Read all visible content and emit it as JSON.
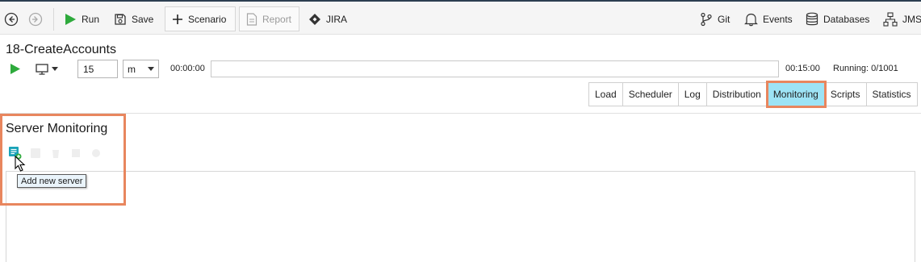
{
  "toolbar": {
    "run_label": "Run",
    "save_label": "Save",
    "scenario_label": "Scenario",
    "report_label": "Report",
    "jira_label": "JIRA",
    "git_label": "Git",
    "events_label": "Events",
    "databases_label": "Databases",
    "jms_label": "JMS"
  },
  "test": {
    "title": "18-CreateAccounts",
    "duration_value": "15",
    "duration_unit": "m",
    "elapsed_time": "00:00:00",
    "end_time": "00:15:00",
    "running_status": "Running: 0/1001",
    "progress_fraction": 0
  },
  "tabs": [
    {
      "label": "Load"
    },
    {
      "label": "Scheduler"
    },
    {
      "label": "Log"
    },
    {
      "label": "Distribution"
    },
    {
      "label": "Monitoring",
      "active": true
    },
    {
      "label": "Scripts"
    },
    {
      "label": "Statistics"
    }
  ],
  "monitoring": {
    "title": "Server Monitoring",
    "tooltip": "Add new server"
  },
  "colors": {
    "accent_green": "#2eaa3c",
    "active_tab": "#9de3f5",
    "highlight": "#e8865e",
    "toolbar_bg": "#f5f5f5"
  }
}
